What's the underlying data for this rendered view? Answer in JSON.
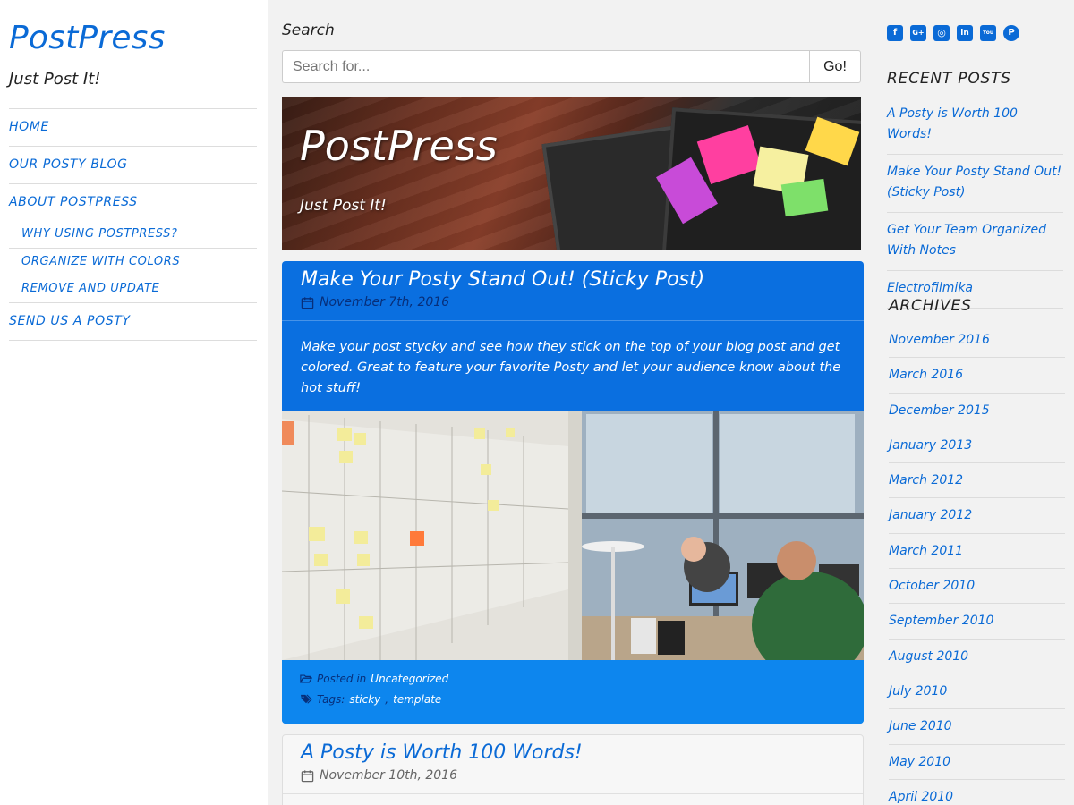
{
  "site": {
    "title": "PostPress",
    "tagline": "Just Post It!"
  },
  "nav": {
    "items": [
      {
        "label": "Home"
      },
      {
        "label": "Our Posty Blog"
      },
      {
        "label": "About PostPress",
        "children": [
          {
            "label": "Why using PostPress?"
          },
          {
            "label": "Organize with Colors"
          },
          {
            "label": "Remove and Update"
          }
        ]
      },
      {
        "label": "Send us a Posty"
      }
    ]
  },
  "search": {
    "label": "Search",
    "placeholder": "Search for...",
    "button": "Go!"
  },
  "banner": {
    "title": "PostPress",
    "tagline": "Just Post It!"
  },
  "posts": [
    {
      "title": "Make Your Posty Stand Out! (Sticky Post)",
      "date": "November 7th, 2016",
      "excerpt": "Make your post stycky and see how they stick on the top of your blog post and get colored. Great to feature your favorite Posty and let your audience know about the hot stuff!",
      "posted_in_label": "Posted in",
      "category": "Uncategorized",
      "tags_label": "Tags:",
      "tags": [
        "sticky",
        "template"
      ],
      "tag_separator": ","
    },
    {
      "title": "A Posty is Worth 100 Words!",
      "date": "November 10th, 2016"
    }
  ],
  "social": {
    "icons": [
      "facebook-icon",
      "google-plus-icon",
      "instagram-icon",
      "linkedin-icon",
      "youtube-icon",
      "pinterest-icon"
    ],
    "glyphs": [
      "f",
      "G+",
      "◎",
      "in",
      "You",
      "P"
    ]
  },
  "recent_posts": {
    "title": "Recent Posts",
    "items": [
      "A Posty is Worth 100 Words!",
      "Make Your Posty Stand Out! (Sticky Post)",
      "Get Your Team Organized With Notes",
      "Electrofilmika"
    ]
  },
  "archives": {
    "title": "Archives",
    "items": [
      "November 2016",
      "March 2016",
      "December 2015",
      "January 2013",
      "March 2012",
      "January 2012",
      "March 2011",
      "October 2010",
      "September 2010",
      "August 2010",
      "July 2010",
      "June 2010",
      "May 2010",
      "April 2010"
    ]
  },
  "colors": {
    "accent": "#0a6ad6",
    "sticky_bg": "#0a6fe0",
    "sticky_footer_bg": "#0d86ee",
    "page_bg": "#f2f2f2"
  }
}
